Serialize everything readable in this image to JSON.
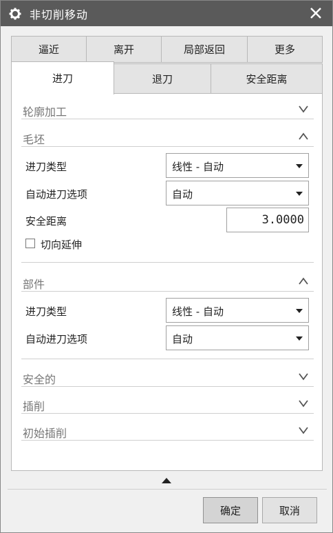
{
  "window": {
    "title": "非切削移动",
    "title_icon": "gear-icon",
    "close_icon": "close-icon"
  },
  "tabs_row1": [
    "逼近",
    "离开",
    "局部返回",
    "更多"
  ],
  "tabs_row2": [
    "进刀",
    "退刀",
    "安全距离"
  ],
  "active_tab": "进刀",
  "sections": {
    "profile": {
      "label": "轮廓加工",
      "expanded": false
    },
    "blank": {
      "label": "毛坯",
      "expanded": true,
      "engage_type_label": "进刀类型",
      "engage_type_value": "线性 - 自动",
      "auto_engage_label": "自动进刀选项",
      "auto_engage_value": "自动",
      "safe_dist_label": "安全距离",
      "safe_dist_value": "3.0000",
      "tangent_ext_label": "切向延伸",
      "tangent_ext_checked": false
    },
    "part": {
      "label": "部件",
      "expanded": true,
      "engage_type_label": "进刀类型",
      "engage_type_value": "线性 - 自动",
      "auto_engage_label": "自动进刀选项",
      "auto_engage_value": "自动"
    },
    "safe": {
      "label": "安全的",
      "expanded": false
    },
    "plunge": {
      "label": "插削",
      "expanded": false
    },
    "initial_plunge": {
      "label": "初始插削",
      "expanded": false
    }
  },
  "buttons": {
    "ok": "确定",
    "cancel": "取消"
  }
}
